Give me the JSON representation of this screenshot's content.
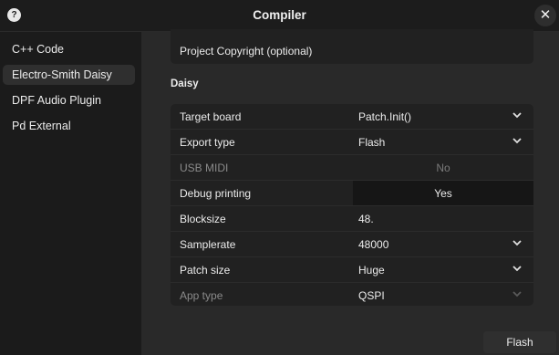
{
  "window": {
    "title": "Compiler"
  },
  "sidebar": {
    "items": [
      {
        "label": "C++ Code"
      },
      {
        "label": "Electro-Smith Daisy"
      },
      {
        "label": "DPF Audio Plugin"
      },
      {
        "label": "Pd External"
      }
    ]
  },
  "main": {
    "copyright_label": "Project Copyright (optional)",
    "section_title": "Daisy",
    "rows": [
      {
        "label": "Target board",
        "value": "Patch.Init()"
      },
      {
        "label": "Export type",
        "value": "Flash"
      },
      {
        "label": "USB MIDI",
        "value": "No"
      },
      {
        "label": "Debug printing",
        "value": "Yes"
      },
      {
        "label": "Blocksize",
        "value": "48."
      },
      {
        "label": "Samplerate",
        "value": "48000"
      },
      {
        "label": "Patch size",
        "value": "Huge"
      },
      {
        "label": "App type",
        "value": "QSPI"
      }
    ],
    "flash_button": "Flash"
  },
  "icons": {
    "help": "?",
    "close": "✕"
  },
  "colors": {
    "background": "#292929",
    "sidebar": "#1b1b1b",
    "panel": "#212121"
  }
}
